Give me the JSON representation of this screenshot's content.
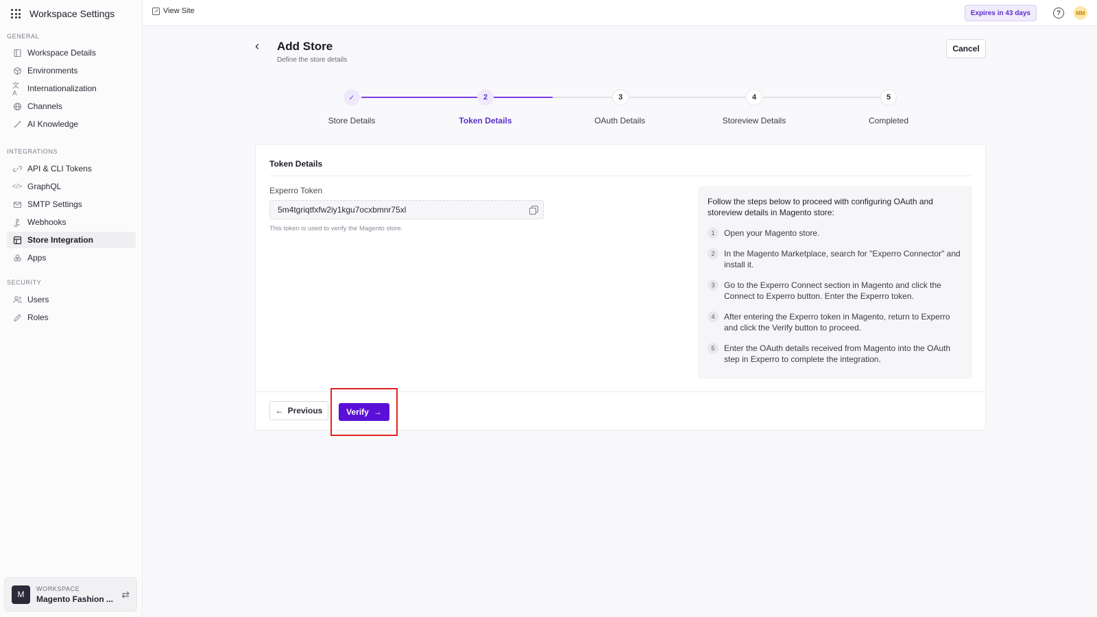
{
  "sidebar": {
    "title": "Workspace Settings",
    "sections": {
      "general": "GENERAL",
      "integrations": "INTEGRATIONS",
      "security": "SECURITY"
    },
    "items": [
      {
        "label": "Workspace Details",
        "icon": "workspace-icon"
      },
      {
        "label": "Environments",
        "icon": "cube-icon"
      },
      {
        "label": "Internationalization",
        "icon": "translate-icon"
      },
      {
        "label": "Channels",
        "icon": "globe-icon"
      },
      {
        "label": "AI Knowledge",
        "icon": "wand-icon"
      },
      {
        "label": "API & CLI Tokens",
        "icon": "link-icon"
      },
      {
        "label": "GraphQL",
        "icon": "code-icon"
      },
      {
        "label": "SMTP Settings",
        "icon": "mail-icon"
      },
      {
        "label": "Webhooks",
        "icon": "webhook-icon"
      },
      {
        "label": "Store Integration",
        "icon": "store-icon",
        "active": true
      },
      {
        "label": "Apps",
        "icon": "apps-icon"
      },
      {
        "label": "Users",
        "icon": "users-icon"
      },
      {
        "label": "Roles",
        "icon": "pen-icon"
      }
    ],
    "workspace": {
      "label": "WORKSPACE",
      "avatar": "M",
      "name": "Magento Fashion ..."
    }
  },
  "topbar": {
    "view_site": "View Site",
    "expires": "Expires in 43 days",
    "user_initials": "MM"
  },
  "page": {
    "title": "Add Store",
    "subtitle": "Define the store details",
    "cancel": "Cancel"
  },
  "stepper": {
    "steps": [
      {
        "number": "✓",
        "label": "Store Details",
        "state": "complete"
      },
      {
        "number": "2",
        "label": "Token Details",
        "state": "current"
      },
      {
        "number": "3",
        "label": "OAuth Details",
        "state": "upcoming"
      },
      {
        "number": "4",
        "label": "Storeview Details",
        "state": "upcoming"
      },
      {
        "number": "5",
        "label": "Completed",
        "state": "upcoming"
      }
    ]
  },
  "card": {
    "title": "Token Details",
    "token_label": "Experro Token",
    "token_value": "5m4tgriqtfxfw2iy1kgu7ocxbmnr75xl",
    "token_helper": "This token is used to verify the Magento store.",
    "instructions_intro": "Follow the steps below to proceed with configuring OAuth and storeview details in Magento store:",
    "instructions": [
      {
        "num": "1",
        "text": "Open your Magento store."
      },
      {
        "num": "2",
        "text": "In the Magento Marketplace, search for \"Experro Connector\" and install it."
      },
      {
        "num": "3",
        "text": "Go to the Experro Connect section in Magento and click the Connect to Experro button. Enter the Experro token."
      },
      {
        "num": "4",
        "text": "After entering the Experro token in Magento, return to Experro and click the Verify button to proceed."
      },
      {
        "num": "5",
        "text": "Enter the OAuth details received from Magento into the OAuth step in Experro to complete the integration."
      }
    ],
    "previous": "Previous",
    "verify": "Verify"
  },
  "colors": {
    "accent": "#5a10d6",
    "step_active": "#7b3fe4",
    "highlight": "#e02020"
  }
}
